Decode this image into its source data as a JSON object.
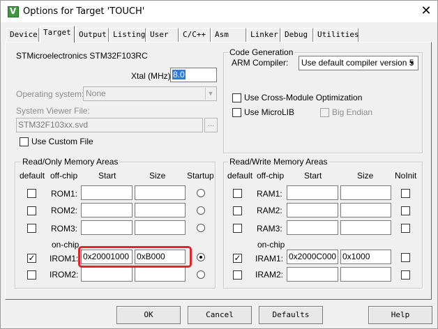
{
  "window": {
    "title": "Options for Target 'TOUCH'",
    "app_icon_glyph": "V",
    "close_glyph": "✕"
  },
  "tabs": [
    {
      "label": "Device"
    },
    {
      "label": "Target"
    },
    {
      "label": "Output"
    },
    {
      "label": "Listing"
    },
    {
      "label": "User"
    },
    {
      "label": "C/C++"
    },
    {
      "label": "Asm"
    },
    {
      "label": "Linker"
    },
    {
      "label": "Debug"
    },
    {
      "label": "Utilities"
    }
  ],
  "active_tab": "Target",
  "device": {
    "name": "STMicroelectronics STM32F103RC",
    "xtal_label": "Xtal (MHz):",
    "xtal_value": "8.0",
    "os_label": "Operating system:",
    "os_value": "None",
    "svd_label": "System Viewer File:",
    "svd_value": "STM32F103xx.svd",
    "browse_label": "...",
    "custom_file_label": "Use Custom File",
    "custom_file_checked": false
  },
  "code_generation": {
    "group_label": "Code Generation",
    "compiler_label": "ARM Compiler:",
    "compiler_value": "Use default compiler version 5",
    "cross_module_label": "Use Cross-Module Optimization",
    "cross_module_checked": false,
    "microlib_label": "Use MicroLIB",
    "microlib_checked": false,
    "big_endian_label": "Big Endian",
    "big_endian_checked": false
  },
  "ro_memory": {
    "group_label": "Read/Only Memory Areas",
    "headers": {
      "default": "default",
      "offchip": "off-chip",
      "start": "Start",
      "size": "Size",
      "startup": "Startup"
    },
    "onchip_label": "on-chip",
    "rows": [
      {
        "name": "ROM1:",
        "default": false,
        "start": "",
        "size": "",
        "startup": false
      },
      {
        "name": "ROM2:",
        "default": false,
        "start": "",
        "size": "",
        "startup": false
      },
      {
        "name": "ROM3:",
        "default": false,
        "start": "",
        "size": "",
        "startup": false
      },
      {
        "name": "IROM1:",
        "default": true,
        "start": "0x20001000",
        "size": "0xB000",
        "startup": true
      },
      {
        "name": "IROM2:",
        "default": false,
        "start": "",
        "size": "",
        "startup": false
      }
    ]
  },
  "rw_memory": {
    "group_label": "Read/Write Memory Areas",
    "headers": {
      "default": "default",
      "offchip": "off-chip",
      "start": "Start",
      "size": "Size",
      "noinit": "NoInit"
    },
    "onchip_label": "on-chip",
    "rows": [
      {
        "name": "RAM1:",
        "default": false,
        "start": "",
        "size": "",
        "noinit": false
      },
      {
        "name": "RAM2:",
        "default": false,
        "start": "",
        "size": "",
        "noinit": false
      },
      {
        "name": "RAM3:",
        "default": false,
        "start": "",
        "size": "",
        "noinit": false
      },
      {
        "name": "IRAM1:",
        "default": true,
        "start": "0x2000C000",
        "size": "0x1000",
        "noinit": false
      },
      {
        "name": "IRAM2:",
        "default": false,
        "start": "",
        "size": "",
        "noinit": false
      }
    ]
  },
  "buttons": {
    "ok": "OK",
    "cancel": "Cancel",
    "defaults": "Defaults",
    "help": "Help"
  },
  "colors": {
    "highlight": "#e0262a",
    "icon_green": "#3f9a3f"
  }
}
